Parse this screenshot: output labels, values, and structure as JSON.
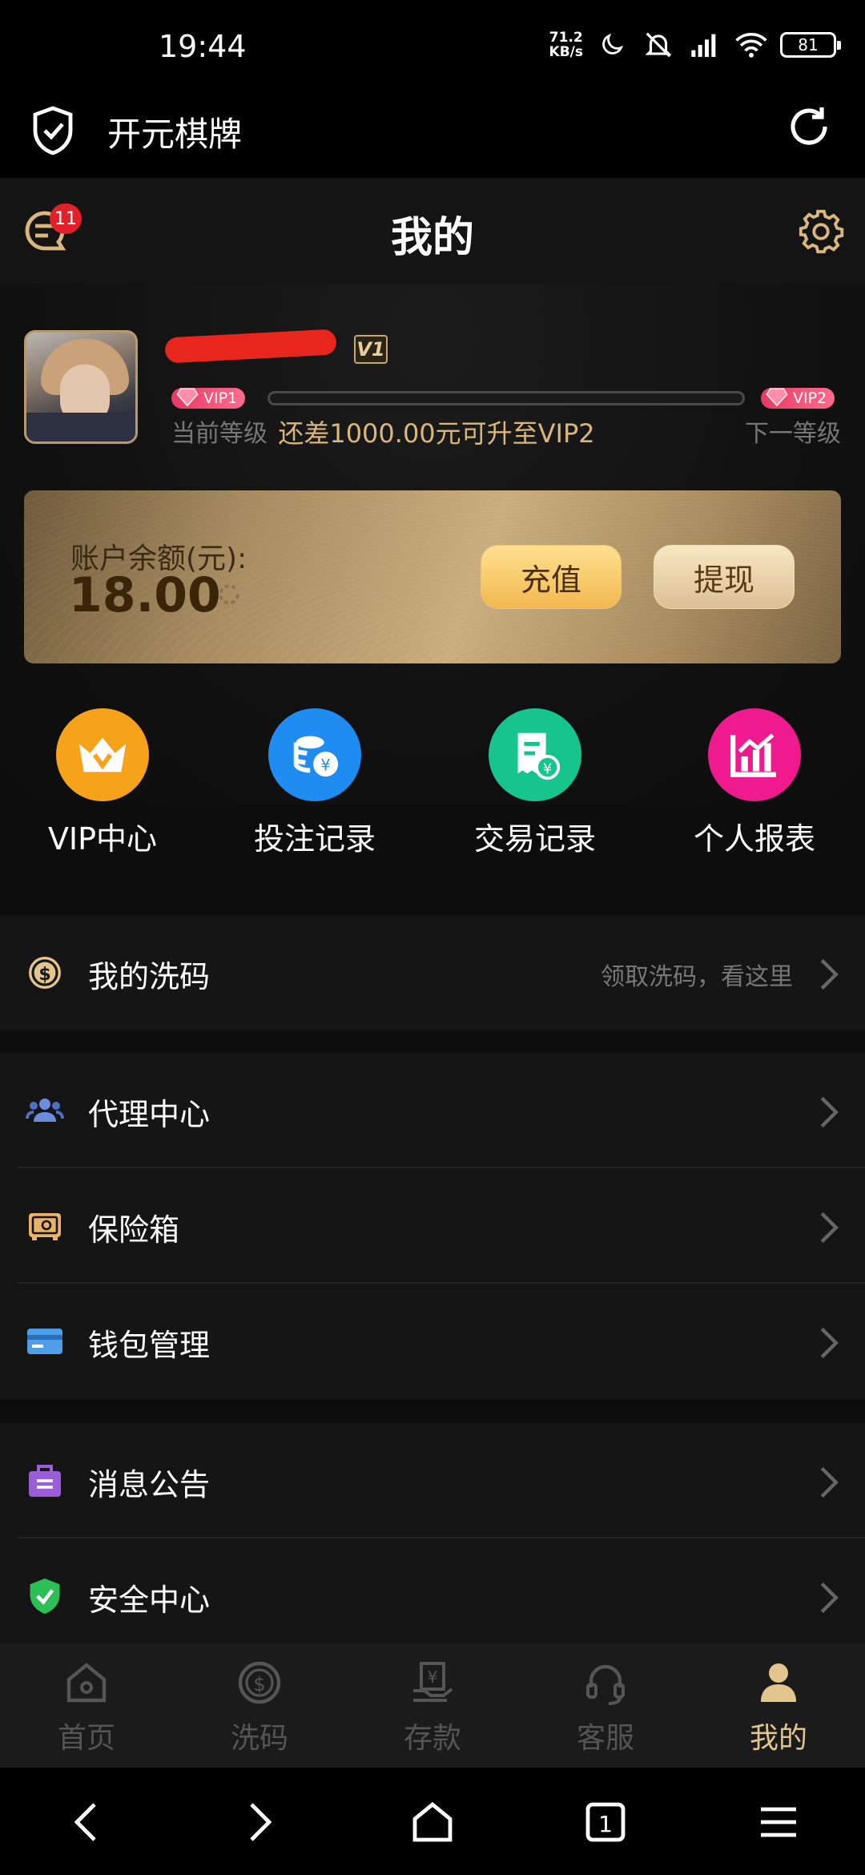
{
  "status_bar": {
    "time": "19:44",
    "speed_top": "71.2",
    "speed_bottom": "KB/s",
    "battery": "81"
  },
  "browser": {
    "title": "开元棋牌"
  },
  "header": {
    "title": "我的",
    "message_badge": "11"
  },
  "profile": {
    "vip_icon_text": "V1",
    "current_vip": "VIP1",
    "next_vip": "VIP2",
    "current_level_label": "当前等级",
    "next_level_label": "下一等级",
    "upgrade_tip": "还差1000.00元可升至VIP2",
    "progress": 0
  },
  "balance": {
    "label": "账户余额(元):",
    "amount": "18.00",
    "recharge_label": "充值",
    "withdraw_label": "提现"
  },
  "quick_actions": [
    {
      "label": "VIP中心",
      "icon": "vip-crown-icon",
      "color": "#f7a21b"
    },
    {
      "label": "投注记录",
      "icon": "coins-icon",
      "color": "#1e8cf0"
    },
    {
      "label": "交易记录",
      "icon": "receipt-icon",
      "color": "#17c48b"
    },
    {
      "label": "个人报表",
      "icon": "chart-icon",
      "color": "#ef1b8e"
    }
  ],
  "menu": {
    "rebate": {
      "label": "我的洗码",
      "hint": "领取洗码，看这里"
    },
    "agent": {
      "label": "代理中心"
    },
    "safe": {
      "label": "保险箱"
    },
    "wallet": {
      "label": "钱包管理"
    },
    "notice": {
      "label": "消息公告"
    },
    "security": {
      "label": "安全中心"
    }
  },
  "tabs": [
    {
      "label": "首页",
      "icon": "home-icon"
    },
    {
      "label": "洗码",
      "icon": "dollar-icon"
    },
    {
      "label": "存款",
      "icon": "deposit-icon"
    },
    {
      "label": "客服",
      "icon": "headset-icon"
    },
    {
      "label": "我的",
      "icon": "user-icon",
      "active": true
    }
  ],
  "colors": {
    "accent_gold": "#d9b77c",
    "vip_pink": "#e53a64"
  }
}
